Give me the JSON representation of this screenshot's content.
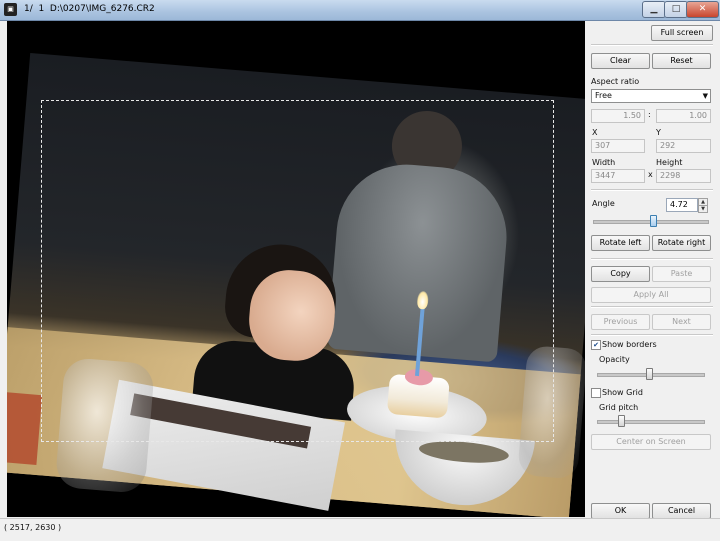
{
  "window": {
    "title": "1/  1  D:\\0207\\IMG_6276.CR2",
    "icons": [
      "app-icon",
      "minimize-icon",
      "maximize-icon",
      "close-icon"
    ]
  },
  "panel": {
    "full_screen": "Full screen",
    "clear": "Clear",
    "reset": "Reset",
    "aspect_ratio_label": "Aspect ratio",
    "aspect_ratio_value": "Free",
    "ratio_a": "1.50",
    "ratio_sep": ":",
    "ratio_b": "1.00",
    "x_label": "X",
    "y_label": "Y",
    "x_value": "307",
    "y_value": "292",
    "width_label": "Width",
    "height_label": "Height",
    "width_value": "3447",
    "times": "x",
    "height_value": "2298",
    "angle_label": "Angle",
    "angle_value": "4.72",
    "rotate_left": "Rotate left",
    "rotate_right": "Rotate right",
    "copy": "Copy",
    "paste": "Paste",
    "apply_all": "Apply All",
    "previous": "Previous",
    "next": "Next",
    "show_borders": "Show borders",
    "show_borders_checked": true,
    "opacity_label": "Opacity",
    "show_grid": "Show Grid",
    "show_grid_checked": false,
    "grid_pitch_label": "Grid pitch",
    "center_on_screen": "Center on Screen",
    "ok": "OK",
    "cancel": "Cancel"
  },
  "status": {
    "coords": "( 2517, 2630 )"
  },
  "colors": {
    "titlebar": "#aac3e0",
    "viewer_bg": "#000000",
    "panel_bg": "#f0f0f0",
    "slider_accent": "#3c7fb1"
  }
}
